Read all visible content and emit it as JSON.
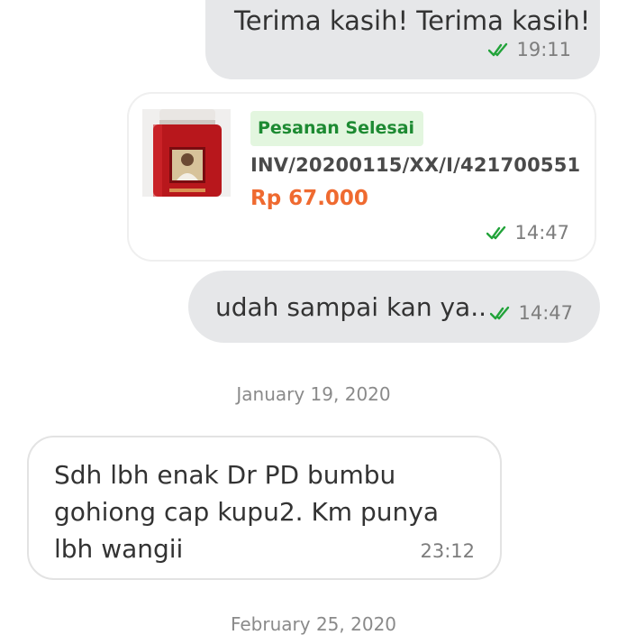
{
  "messages": [
    {
      "id": "msg1",
      "direction": "outgoing",
      "text": "Terima kasih! Terima kasih!",
      "time": "19:11",
      "status": "read"
    },
    {
      "id": "card",
      "direction": "outgoing",
      "type": "order-card",
      "badge": "Pesanan Selesai",
      "invoice": "INV/20200115/XX/I/421700551",
      "price": "Rp 67.000",
      "time": "14:47",
      "status": "read"
    },
    {
      "id": "msg2",
      "direction": "outgoing",
      "text": "udah sampai kan ya..",
      "time": "14:47",
      "status": "read"
    },
    {
      "id": "msg3",
      "direction": "incoming",
      "text": "Sdh lbh enak Dr PD bumbu gohiong cap kupu2. Km punya lbh wangii",
      "time": "23:12"
    }
  ],
  "date_separators": [
    "January 19, 2020",
    "February 25, 2020"
  ],
  "colors": {
    "outgoing_bubble": "#e6e7e9",
    "read_check": "#22a33a",
    "badge_bg": "#e3f6df",
    "badge_text": "#1d8a32",
    "price": "#ef6a30"
  },
  "icons": {
    "read_receipt": "double-check-icon",
    "product_image": "product-thumbnail"
  }
}
